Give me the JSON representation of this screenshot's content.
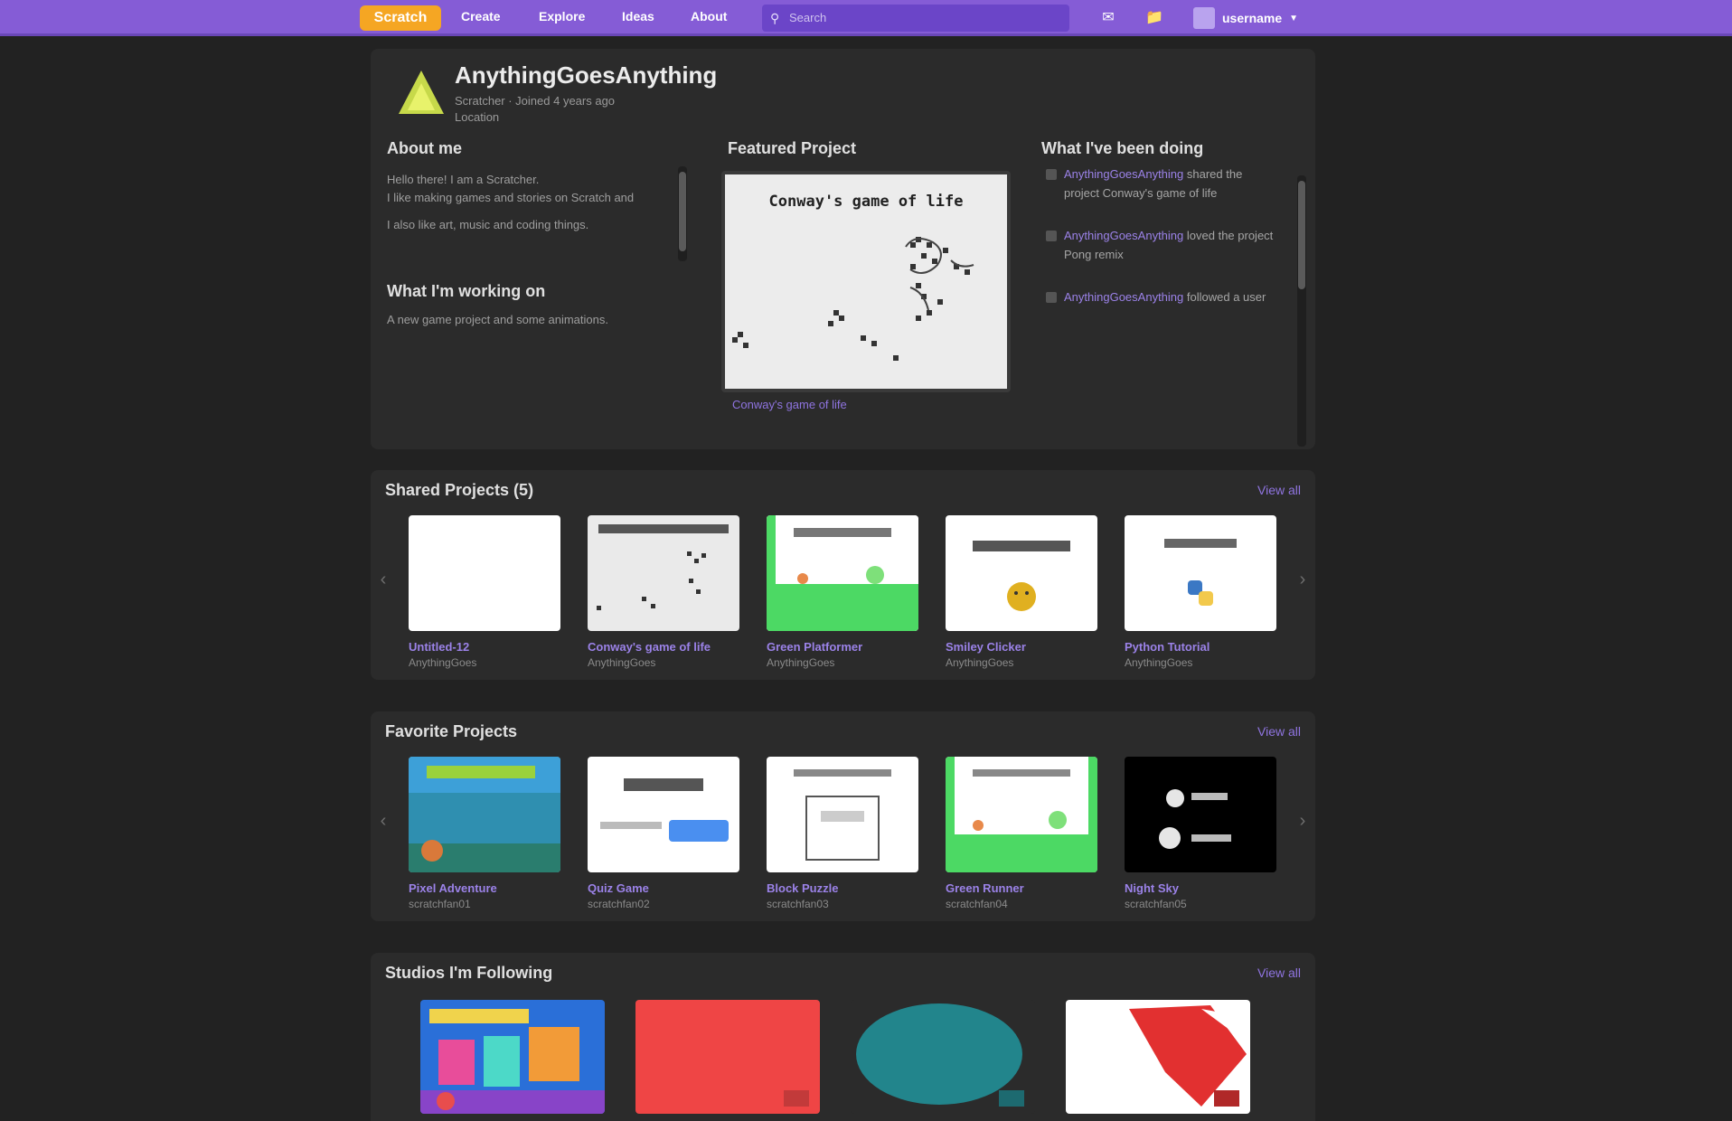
{
  "nav": {
    "logo": "Scratch",
    "links": [
      "Create",
      "Explore",
      "Ideas",
      "About"
    ],
    "search_placeholder": "Search",
    "username": "username"
  },
  "profile": {
    "name": "AnythingGoesAnything",
    "meta_line1": "Scratcher · Joined 4 years ago",
    "meta_line2": "Location"
  },
  "about": {
    "heading": "About me",
    "line1": "Hello there! I am a Scratcher.",
    "line2": "I like making games and stories on Scratch and",
    "line3": "I also like art, music and coding things.",
    "working_heading": "What I'm working on",
    "working_line": "A new game project and some animations."
  },
  "featured": {
    "heading": "Featured Project",
    "project_title": "Conway's game of life",
    "link_text": "Conway's game of life"
  },
  "activity": {
    "heading": "What I've been doing",
    "items": [
      {
        "link": "AnythingGoesAnything",
        "text": "shared the project Conway's game of life"
      },
      {
        "link": "AnythingGoesAnything",
        "text": "loved the project Pong remix"
      },
      {
        "link": "AnythingGoesAnything",
        "text": "followed a user"
      }
    ]
  },
  "sections": [
    {
      "title": "Shared Projects (5)",
      "view_all": "View all",
      "cards": [
        {
          "title": "Untitled-12",
          "sub": "AnythingGoes"
        },
        {
          "title": "Conway's game of life",
          "sub": "AnythingGoes"
        },
        {
          "title": "Green Platformer",
          "sub": "AnythingGoes"
        },
        {
          "title": "Smiley Clicker",
          "sub": "AnythingGoes"
        },
        {
          "title": "Python Tutorial",
          "sub": "AnythingGoes"
        }
      ]
    },
    {
      "title": "Favorite Projects",
      "view_all": "View all",
      "cards": [
        {
          "title": "Pixel Adventure",
          "sub": "scratchfan01"
        },
        {
          "title": "Quiz Game",
          "sub": "scratchfan02"
        },
        {
          "title": "Block Puzzle",
          "sub": "scratchfan03"
        },
        {
          "title": "Green Runner",
          "sub": "scratchfan04"
        },
        {
          "title": "Night Sky",
          "sub": "scratchfan05"
        }
      ]
    },
    {
      "title": "Studios I'm Following",
      "view_all": "View all"
    }
  ],
  "colors": {
    "nav": "#855cd6",
    "background": "#222222",
    "panel": "#2b2b2b",
    "link": "#9b82e8"
  }
}
